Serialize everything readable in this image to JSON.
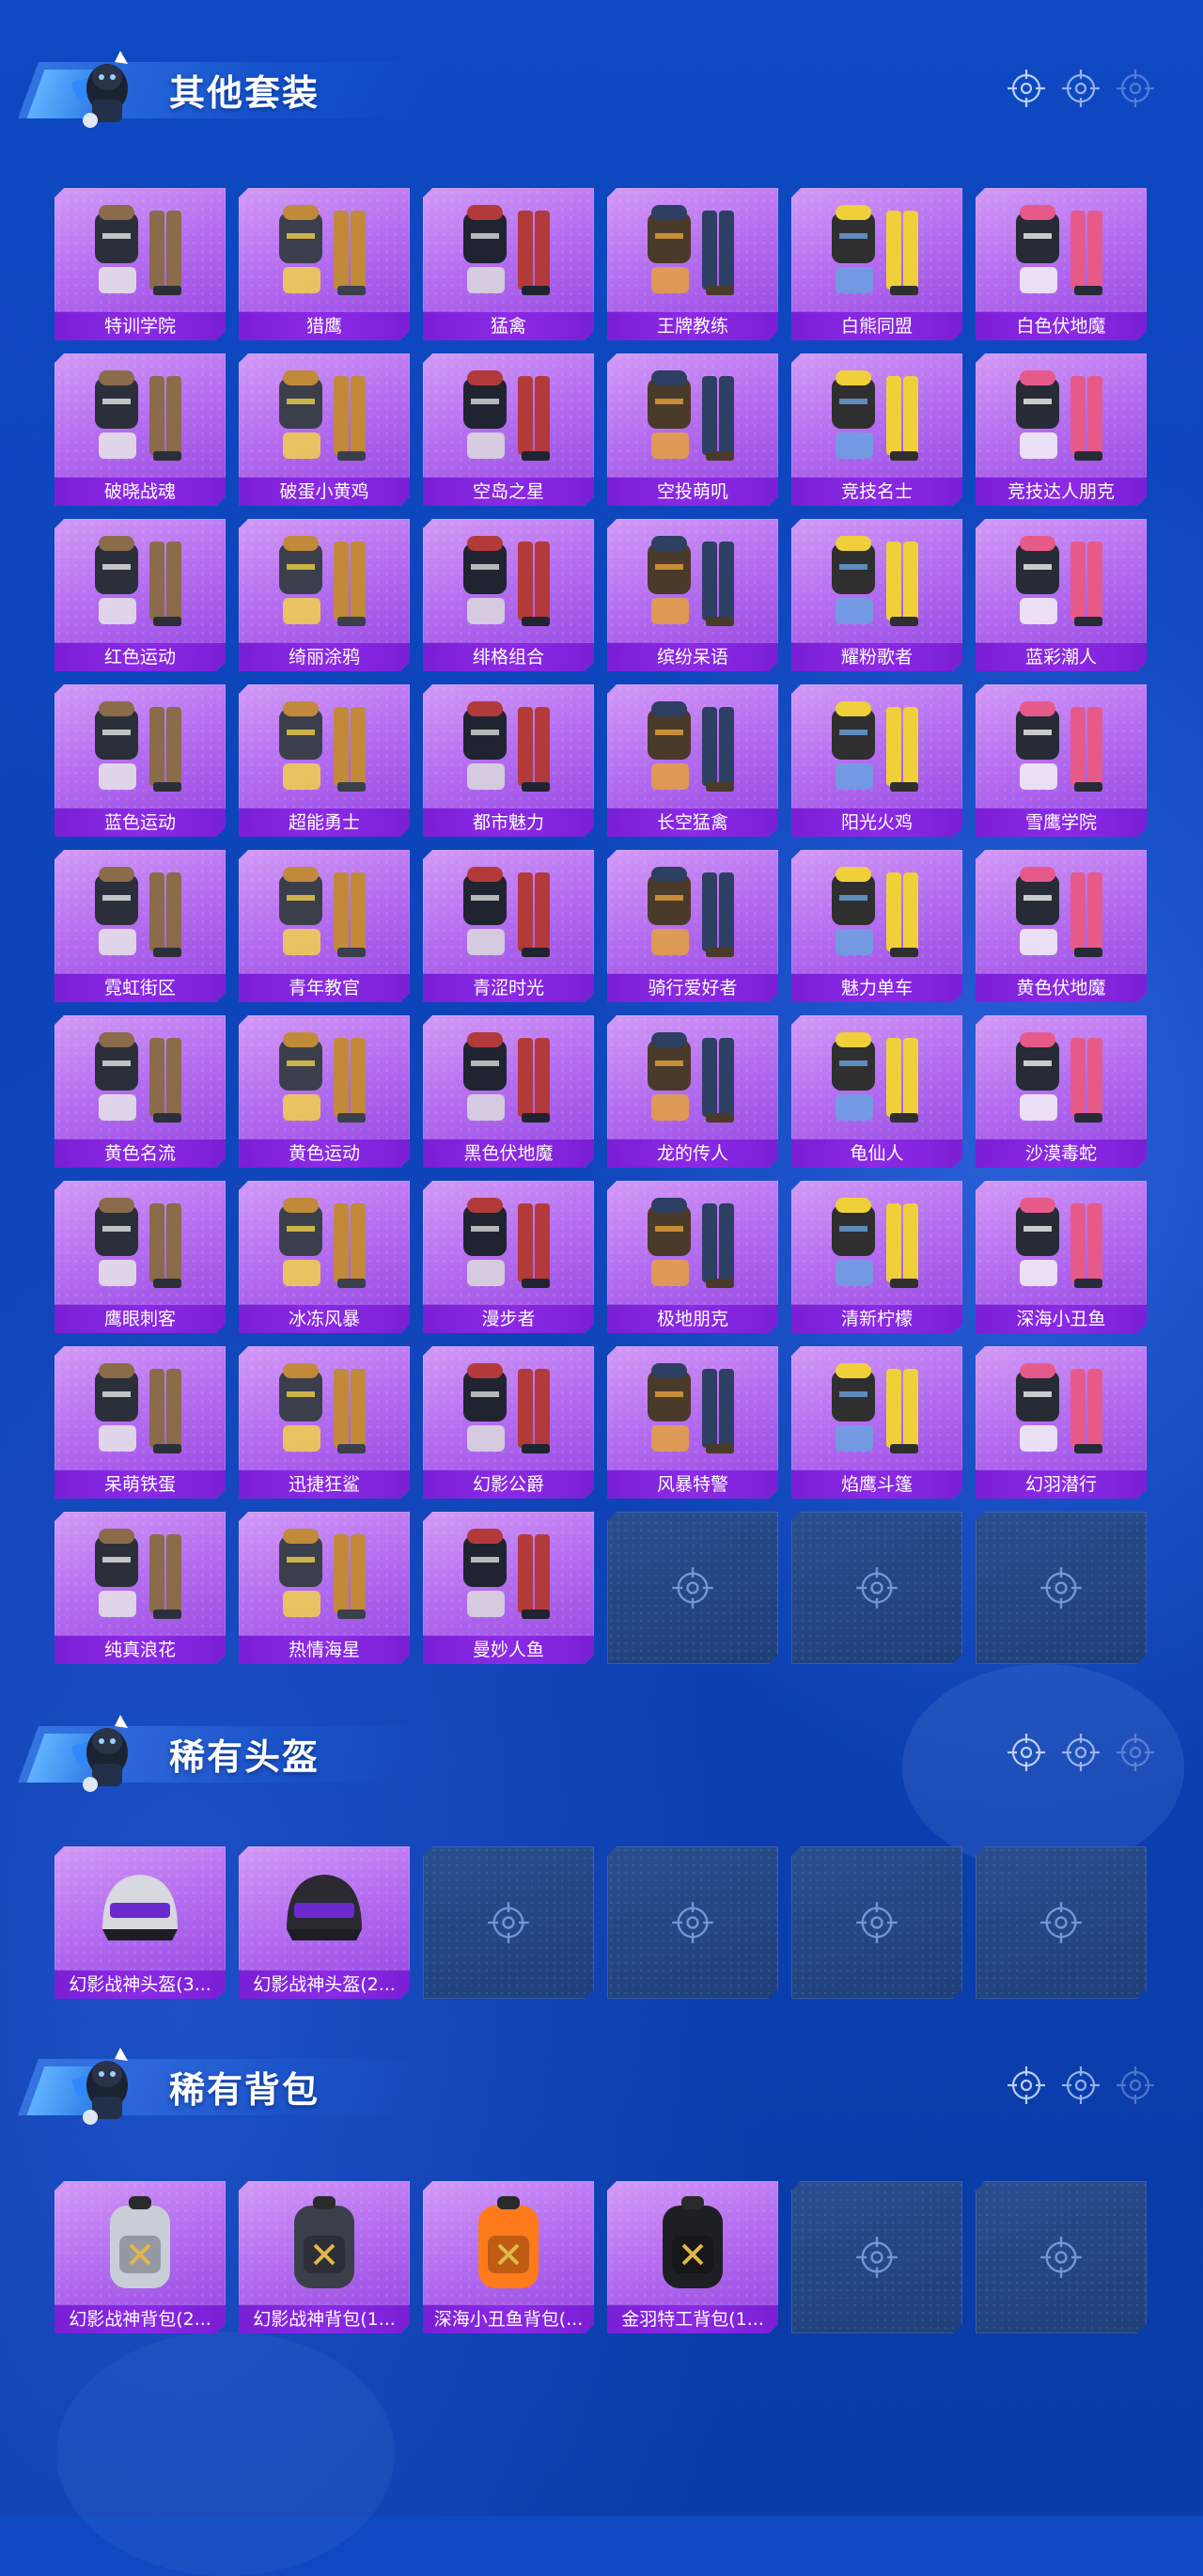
{
  "sections": [
    {
      "title": "其他套装",
      "items": [
        "特训学院",
        "猎鹰",
        "猛禽",
        "王牌教练",
        "白熊同盟",
        "白色伏地魔",
        "破晓战魂",
        "破蛋小黄鸡",
        "空岛之星",
        "空投萌叽",
        "竞技名士",
        "竞技达人朋克",
        "红色运动",
        "绮丽涂鸦",
        "绯格组合",
        "缤纷呆语",
        "耀粉歌者",
        "蓝彩潮人",
        "蓝色运动",
        "超能勇士",
        "都市魅力",
        "长空猛禽",
        "阳光火鸡",
        "雪鹰学院",
        "霓虹街区",
        "青年教官",
        "青涩时光",
        "骑行爱好者",
        "魅力单车",
        "黄色伏地魔",
        "黄色名流",
        "黄色运动",
        "黑色伏地魔",
        "龙的传人",
        "龟仙人",
        "沙漠毒蛇",
        "鹰眼刺客",
        "冰冻风暴",
        "漫步者",
        "极地朋克",
        "清新柠檬",
        "深海小丑鱼",
        "呆萌铁蛋",
        "迅捷狂鲨",
        "幻影公爵",
        "风暴特警",
        "焰鹰斗篷",
        "幻羽潜行",
        "纯真浪花",
        "热情海星",
        "曼妙人鱼"
      ],
      "empty_slots": 3
    },
    {
      "title": "稀有头盔",
      "items": [
        "幻影战神头盔(3...",
        "幻影战神头盔(2..."
      ],
      "empty_slots": 4
    },
    {
      "title": "稀有背包",
      "items": [
        "幻影战神背包(2...",
        "幻影战神背包(1...",
        "深海小丑鱼背包(...",
        "金羽特工背包(1..."
      ],
      "empty_slots": 2
    }
  ],
  "colors": {
    "background": "#0c42b6",
    "card_top": "#d39bf6",
    "card_bottom": "#9444e0",
    "label_bar": "#7a1fd6",
    "empty_card": "#1f3f78"
  },
  "icons": {
    "section_mascot": "mascot-character-icon",
    "header_decor": "crosshair-icon",
    "empty_slot": "crosshair-icon"
  }
}
